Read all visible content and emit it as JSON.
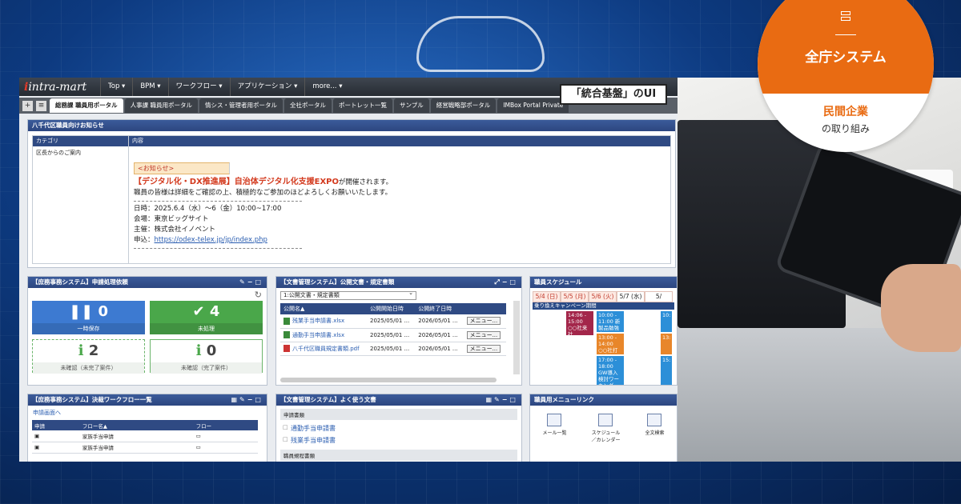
{
  "header": {
    "logo": "intra-mart",
    "menu": [
      "Top ▾",
      "BPM ▾",
      "ワークフロー ▾",
      "アプリケーション ▾",
      "more... ▾"
    ]
  },
  "tabs": [
    "総務課 職員用ポータル",
    "人事課 職員用ポータル",
    "情シス・管理者用ポータル",
    "全社ポータル",
    "ポートレット一覧",
    "サンプル",
    "経営戦略部ポータル",
    "IMBox Portal Private"
  ],
  "ui_label": "「統合基盤」のUI",
  "badge": {
    "title": "全庁システム",
    "line1": "民間企業",
    "line2": "の取り組み",
    "icon": "server-network-icon",
    "color": "#e96b12"
  },
  "notice": {
    "title": "八千代区職員向けお知らせ",
    "col_category": "カテゴリ",
    "col_content": "内容",
    "category": "区長からのご案内",
    "tag": "<お知らせ>",
    "headline": "【デジタル化・DX推進展】自治体デジタル化支援EXPO",
    "headline_tail": "が開催されます。",
    "line2": "職員の皆様は詳細をご確認の上、積極的なご参加のほどよろしくお願いいたします。",
    "date": "日時：2025.6.4（水）～6（金）10:00~17:00",
    "venue": "会場：東京ビッグサイト",
    "host": "主催：株式会社イノベント",
    "apply_prefix": "申込：",
    "apply_url": "https://odex-telex.jp/jp/index.php"
  },
  "approvals": {
    "title": "【庶務事務システム】申請処理依頼",
    "tiles": [
      {
        "value": "0",
        "label": "一時保存"
      },
      {
        "value": "4",
        "label": "未処理"
      },
      {
        "value": "2",
        "label": "未確認（未完了案件）"
      },
      {
        "value": "0",
        "label": "未確認（完了案件）"
      }
    ]
  },
  "docs": {
    "title": "【文書管理システム】公開文書・規定書類",
    "select": "1:公開文書・規定書類",
    "cols": [
      "公開名▲",
      "公開開始日時",
      "公開終了日時"
    ],
    "rows": [
      {
        "name": "残業手当申請書.xlsx",
        "start": "2025/05/01 ...",
        "end": "2026/05/01 ...",
        "btn": "メニュー..."
      },
      {
        "name": "通勤手当申請書.xlsx",
        "start": "2025/05/01 ...",
        "end": "2026/05/01 ...",
        "btn": "メニュー..."
      },
      {
        "name": "八千代区職員規定書類.pdf",
        "start": "2025/05/01 ...",
        "end": "2026/05/01 ...",
        "btn": "メニュー..."
      }
    ]
  },
  "schedule": {
    "title": "職員スケジュール",
    "days": [
      "5/4 (日)",
      "5/5 (月)",
      "5/6 (火)",
      "5/7 (水)",
      "5/"
    ],
    "campaign": "乗り換えキャンペーン期間",
    "events": [
      "14:06 - 15:00 ○○社来社",
      "10:00 - 11:00 新製品勉強会",
      "13:00 - 14:00 ○○社打ち合わせ",
      "17:00 - 18:00 GW導入検討ワーキング",
      "10:",
      "13:",
      "15:"
    ]
  },
  "workflow": {
    "title": "【庶務事務システム】決裁ワークフロー一覧",
    "link": "申請画面へ",
    "cols": [
      "申請",
      "フロー名▲",
      "フロー"
    ],
    "rows": [
      "家族手当申請",
      "家族手当申請"
    ]
  },
  "favorites": {
    "title": "【文書管理システム】よく使う文書",
    "section1": "申請書類",
    "links": [
      "通勤手当申請書",
      "残業手当申請書"
    ],
    "section2": "職員規程書類"
  },
  "menulinks": {
    "title": "職員用メニューリンク",
    "items": [
      "メール一覧",
      "スケジュール\n／カレンダー",
      "全文検索"
    ]
  }
}
